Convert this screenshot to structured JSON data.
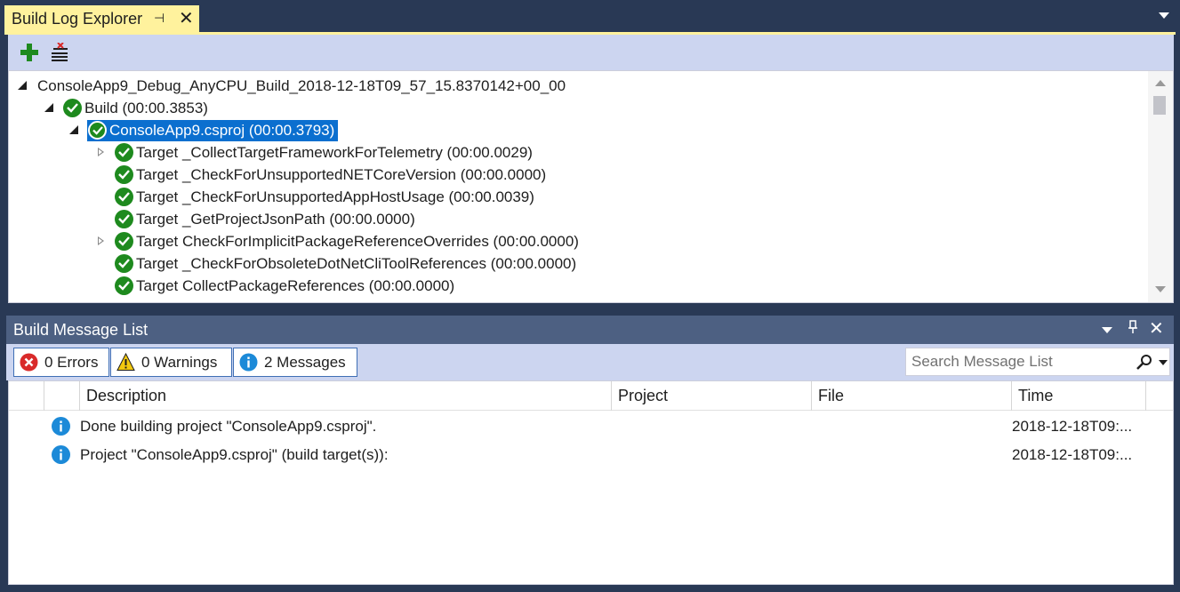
{
  "explorer": {
    "title": "Build Log Explorer",
    "pin_glyph": "⊣",
    "close_glyph": "✕"
  },
  "toolbar": {
    "add_icon": "plus-icon",
    "clear_icon": "clear-list-icon"
  },
  "tree": {
    "root": "ConsoleApp9_Debug_AnyCPU_Build_2018-12-18T09_57_15.8370142+00_00",
    "build": "Build (00:00.3853)",
    "project": "ConsoleApp9.csproj (00:00.3793)",
    "targets": [
      {
        "label": "Target _CollectTargetFrameworkForTelemetry (00:00.0029)",
        "expandable": true
      },
      {
        "label": "Target _CheckForUnsupportedNETCoreVersion (00:00.0000)",
        "expandable": false
      },
      {
        "label": "Target _CheckForUnsupportedAppHostUsage (00:00.0039)",
        "expandable": false
      },
      {
        "label": "Target _GetProjectJsonPath (00:00.0000)",
        "expandable": false
      },
      {
        "label": "Target CheckForImplicitPackageReferenceOverrides (00:00.0000)",
        "expandable": true
      },
      {
        "label": "Target _CheckForObsoleteDotNetCliToolReferences (00:00.0000)",
        "expandable": false
      },
      {
        "label": "Target CollectPackageReferences (00:00.0000)",
        "expandable": false
      }
    ]
  },
  "message_list": {
    "title": "Build Message List",
    "filters": {
      "errors": "0 Errors",
      "warnings": "0 Warnings",
      "messages": "2 Messages"
    },
    "search_placeholder": "Search Message List",
    "columns": [
      "Description",
      "Project",
      "File",
      "Time"
    ],
    "rows": [
      {
        "description": "Done building project \"ConsoleApp9.csproj\".",
        "project": "",
        "file": "",
        "time": "2018-12-18T09:..."
      },
      {
        "description": "Project \"ConsoleApp9.csproj\" (build target(s)):",
        "project": "",
        "file": "",
        "time": "2018-12-18T09:..."
      }
    ]
  },
  "colors": {
    "background": "#293955",
    "active_tab": "#fff29d",
    "toolbar": "#ccd5f0",
    "titlebar": "#4d6082",
    "selection": "#0b6fcf",
    "success": "#1e8a1e",
    "info": "#1c8ad8",
    "error": "#d92a2a",
    "warning": "#f2c80f"
  }
}
